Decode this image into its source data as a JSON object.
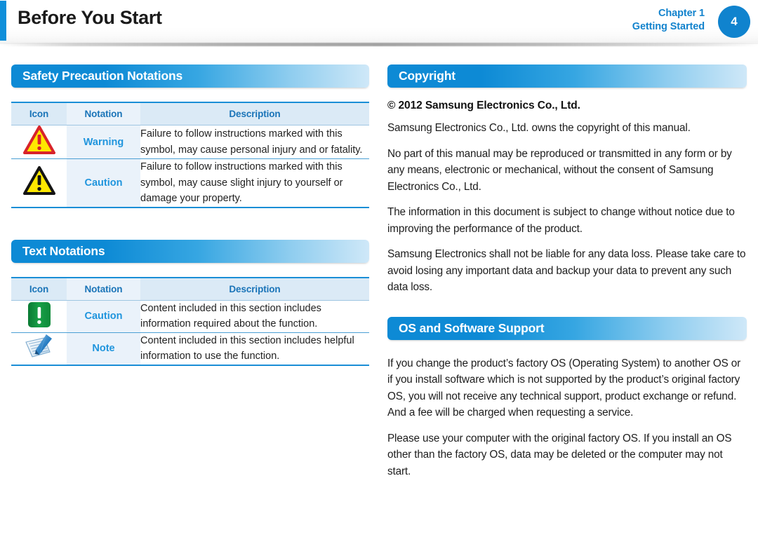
{
  "header": {
    "title": "Before You Start",
    "chapter_label": "Chapter 1",
    "chapter_name": "Getting Started",
    "page_number": "4",
    "accent_color": "#0f8fda",
    "chapter_text_color": "#1383cd",
    "badge_color": "#1083ce"
  },
  "left_column": {
    "sections": [
      {
        "heading": "Safety Precaution Notations",
        "table": {
          "columns": [
            "Icon",
            "Notation",
            "Description"
          ],
          "rows": [
            {
              "icon": "warning-triangle-red-icon",
              "notation": "Warning",
              "description": "Failure to follow instructions marked with this symbol, may cause personal injury and or fatality."
            },
            {
              "icon": "caution-triangle-black-icon",
              "notation": "Caution",
              "description": "Failure to follow instructions marked with this symbol, may cause slight injury to yourself or damage your property."
            }
          ]
        }
      },
      {
        "heading": "Text Notations",
        "table": {
          "columns": [
            "Icon",
            "Notation",
            "Description"
          ],
          "rows": [
            {
              "icon": "caution-green-exclamation-icon",
              "notation": "Caution",
              "description": "Content included in this section includes information required about the function."
            },
            {
              "icon": "note-pen-paper-icon",
              "notation": "Note",
              "description": "Content included in this section includes helpful information to use the function."
            }
          ]
        }
      }
    ]
  },
  "right_column": {
    "copyright": {
      "heading": "Copyright",
      "notice": "© 2012 Samsung Electronics Co., Ltd.",
      "paragraphs": [
        "Samsung Electronics Co., Ltd. owns the copyright of this manual.",
        "No part of this manual may be reproduced or transmitted in any form or by any means, electronic or mechanical, without the consent of Samsung Electronics Co., Ltd.",
        "The information in this document is subject to change without notice due to improving the performance of the product.",
        "Samsung Electronics shall not be liable for any data loss. Please take care to avoid losing any important data and backup your data to prevent any such data loss."
      ]
    },
    "os_support": {
      "heading": "OS and Software Support",
      "paragraphs": [
        "If you change the product’s factory OS (Operating System) to another OS or if you install software which is not supported by the product’s original factory OS, you will not receive any technical support, product exchange or refund. And a fee will be charged when requesting a service.",
        "Please use your computer with the original factory OS. If you install an OS other than the factory OS, data may be deleted or the computer may not start."
      ]
    }
  },
  "colors": {
    "section_bar_start": "#0d8ad5",
    "section_bar_end": "#cfe8f8",
    "notation_text": "#2095dd",
    "table_header_text": "#1a74b8",
    "table_header_bg": "#dbeaf6",
    "notation_cell_bg": "#eaf2fa",
    "table_rule": "#1a8ed6",
    "warning_red": "#d8232a",
    "warning_yellow": "#ffe800",
    "caution_green": "#119944"
  }
}
